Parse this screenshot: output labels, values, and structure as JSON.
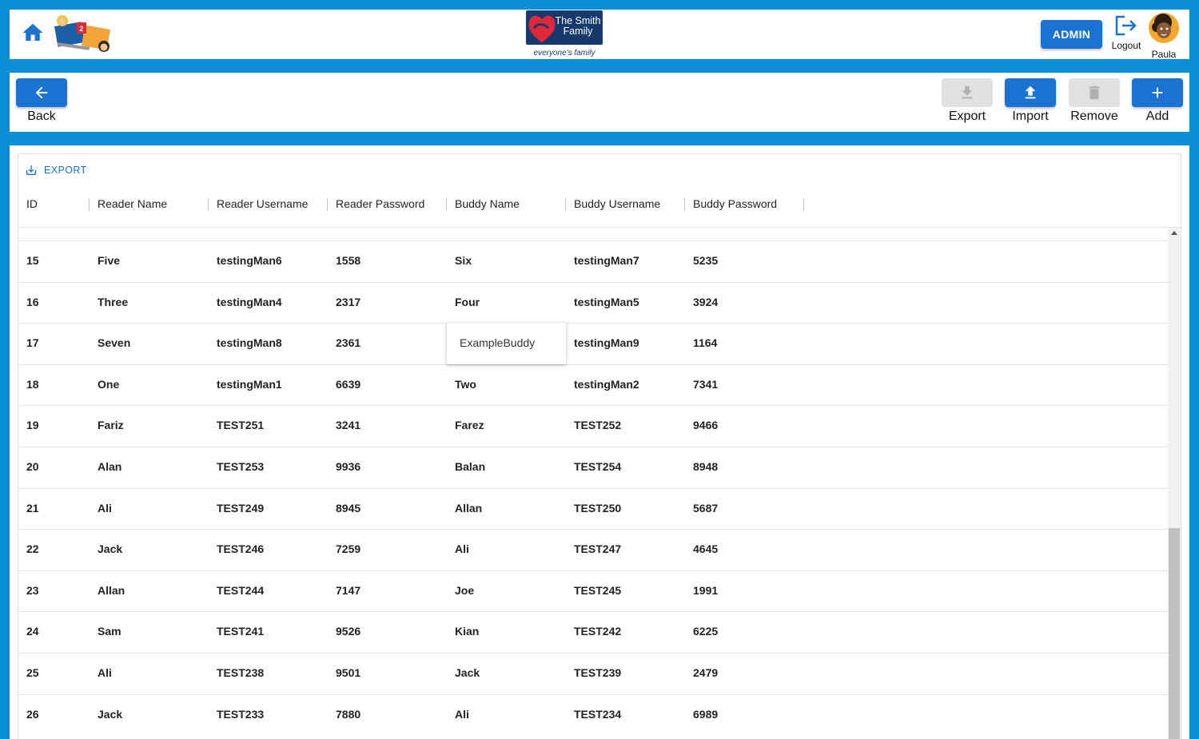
{
  "header": {
    "brand_line1": "The Smith",
    "brand_line2": "Family",
    "tagline": "everyone's family",
    "admin_label": "ADMIN",
    "logout_label": "Logout",
    "user_name": "Paula"
  },
  "toolbar": {
    "back_label": "Back",
    "export_label": "Export",
    "import_label": "Import",
    "remove_label": "Remove",
    "add_label": "Add"
  },
  "grid": {
    "export_link": "EXPORT",
    "columns": [
      "ID",
      "Reader Name",
      "Reader Username",
      "Reader Password",
      "Buddy Name",
      "Buddy Username",
      "Buddy Password"
    ],
    "editing_value": "ExampleBuddy",
    "rows": [
      [
        "15",
        "Five",
        "testingMan6",
        "1558",
        "Six",
        "testingMan7",
        "5235"
      ],
      [
        "16",
        "Three",
        "testingMan4",
        "2317",
        "Four",
        "testingMan5",
        "3924"
      ],
      [
        "17",
        "Seven",
        "testingMan8",
        "2361",
        "",
        "testingMan9",
        "1164"
      ],
      [
        "18",
        "One",
        "testingMan1",
        "6639",
        "Two",
        "testingMan2",
        "7341"
      ],
      [
        "19",
        "Fariz",
        "TEST251",
        "3241",
        "Farez",
        "TEST252",
        "9466"
      ],
      [
        "20",
        "Alan",
        "TEST253",
        "9936",
        "Balan",
        "TEST254",
        "8948"
      ],
      [
        "21",
        "Ali",
        "TEST249",
        "8945",
        "Allan",
        "TEST250",
        "5687"
      ],
      [
        "22",
        "Jack",
        "TEST246",
        "7259",
        "Ali",
        "TEST247",
        "4645"
      ],
      [
        "23",
        "Allan",
        "TEST244",
        "7147",
        "Joe",
        "TEST245",
        "1991"
      ],
      [
        "24",
        "Sam",
        "TEST241",
        "9526",
        "Kian",
        "TEST242",
        "6225"
      ],
      [
        "25",
        "Ali",
        "TEST238",
        "9501",
        "Jack",
        "TEST239",
        "2479"
      ],
      [
        "26",
        "Jack",
        "TEST233",
        "7880",
        "Ali",
        "TEST234",
        "6989"
      ]
    ]
  },
  "colors": {
    "background": "#0a8fd6",
    "primary": "#1a73d1",
    "brand_navy": "#163a6e",
    "brand_red": "#e0283a"
  }
}
